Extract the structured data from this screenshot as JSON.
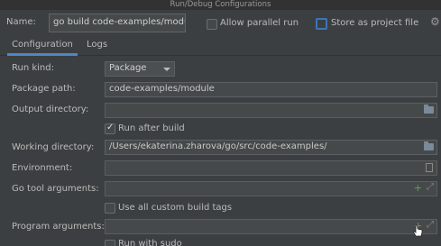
{
  "window": {
    "title": "Run/Debug Configurations"
  },
  "name_row": {
    "label": "Name:",
    "value": "go build code-examples/modul",
    "allow_parallel_label": "Allow parallel run",
    "allow_parallel_checked": false,
    "store_project_label": "Store as project file",
    "store_project_checked": false
  },
  "tabs": [
    {
      "label": "Configuration",
      "active": true
    },
    {
      "label": "Logs",
      "active": false
    }
  ],
  "form": {
    "run_kind": {
      "label": "Run kind:",
      "value": "Package"
    },
    "package_path": {
      "label": "Package path:",
      "value": "code-examples/module"
    },
    "output_directory": {
      "label": "Output directory:",
      "value": ""
    },
    "run_after_build": {
      "label": "Run after build",
      "checked": true
    },
    "working_directory": {
      "label": "Working directory:",
      "value": "/Users/ekaterina.zharova/go/src/code-examples/"
    },
    "environment": {
      "label": "Environment:",
      "value": ""
    },
    "go_tool_arguments": {
      "label": "Go tool arguments:",
      "value": ""
    },
    "use_custom_build_tags": {
      "label": "Use all custom build tags",
      "checked": false
    },
    "program_arguments": {
      "label": "Program arguments:",
      "value": ""
    },
    "run_with_sudo": {
      "label": "Run with sudo",
      "checked": false
    }
  },
  "colors": {
    "background": "#3c3f41",
    "accent": "#4a88c7",
    "field_bg": "#45494a"
  }
}
